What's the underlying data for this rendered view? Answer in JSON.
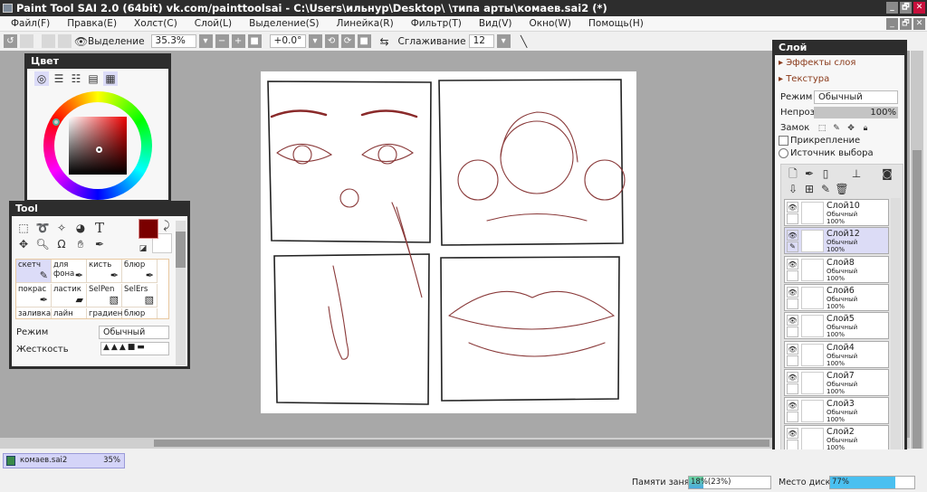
{
  "window": {
    "title": "Paint Tool SAI 2.0 (64bit) vk.com/painttoolsai - C:\\Users\\ильнур\\Desktop\\ \\типа арты\\комаев.sai2 (*)",
    "controls": [
      "_",
      "🗗",
      "✕"
    ]
  },
  "menu": [
    "Файл(F)",
    "Правка(E)",
    "Холст(C)",
    "Слой(L)",
    "Выделение(S)",
    "Линейка(R)",
    "Фильтр(T)",
    "Вид(V)",
    "Окно(W)",
    "Помощь(H)"
  ],
  "toolbar": {
    "selection_label": "Выделение",
    "zoom": "35.3%",
    "rotation": "+0.0°",
    "smoothing_label": "Сглаживание",
    "smoothing": "12"
  },
  "color_panel": {
    "title": "Цвет",
    "primary_color": "#7a0000",
    "secondary_color": "#ffffff"
  },
  "tool_panel": {
    "title": "Tool",
    "brushes": [
      "скетч",
      "для фона",
      "кисть",
      "блюр",
      "покрас",
      "ластик",
      "SelPen",
      "SelErs",
      "заливка",
      "лайн",
      "градиент",
      "блюр"
    ],
    "selected_brush": "скетч",
    "mode_label": "Режим",
    "mode_value": "Обычный",
    "hardness_label": "Жесткость"
  },
  "layer_panel": {
    "title": "Слой",
    "effects": "Эффекты слоя",
    "texture": "Текстура",
    "mode_label": "Режим",
    "mode_value": "Обычный",
    "opacity_label": "Непроз.",
    "opacity": "100%",
    "lock_label": "Замок",
    "clipping_label": "Прикрепление",
    "selection_source_label": "Источник выбора",
    "layers": [
      {
        "name": "Слой10",
        "mode": "Обычный",
        "opacity": "100%"
      },
      {
        "name": "Слой12",
        "mode": "Обычный",
        "opacity": "100%",
        "selected": true
      },
      {
        "name": "Слой8",
        "mode": "Обычный",
        "opacity": "100%"
      },
      {
        "name": "Слой6",
        "mode": "Обычный",
        "opacity": "100%"
      },
      {
        "name": "Слой5",
        "mode": "Обычный",
        "opacity": "100%"
      },
      {
        "name": "Слой4",
        "mode": "Обычный",
        "opacity": "100%"
      },
      {
        "name": "Слой7",
        "mode": "Обычный",
        "opacity": "100%"
      },
      {
        "name": "Слой3",
        "mode": "Обычный",
        "opacity": "100%"
      },
      {
        "name": "Слой2",
        "mode": "Обычный",
        "opacity": "100%"
      }
    ]
  },
  "file_tab": {
    "name": "комаев.sai2",
    "zoom": "35%"
  },
  "status": {
    "memory_label": "Памяти занято",
    "memory_value": "18%",
    "memory_extra": "(23%)",
    "memory_percent": 18,
    "disk_label": "Место диска",
    "disk_value": "77%",
    "disk_percent": 77
  }
}
